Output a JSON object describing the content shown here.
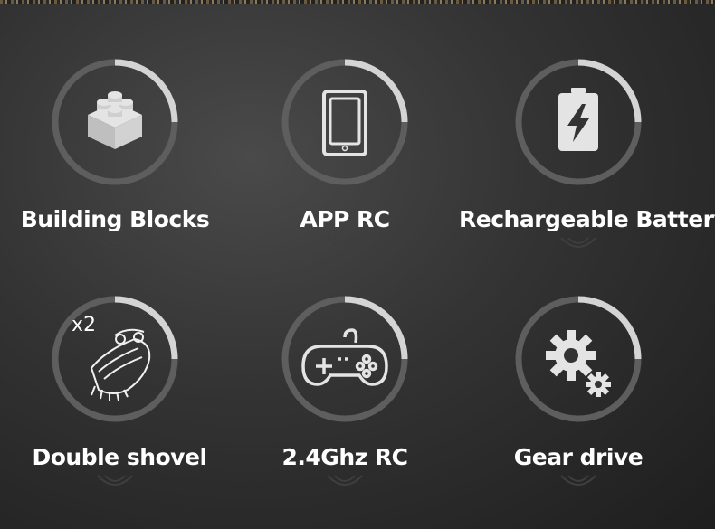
{
  "features": [
    {
      "label": "Building Blocks",
      "icon": "building-blocks-icon"
    },
    {
      "label": "APP RC",
      "icon": "smartphone-icon"
    },
    {
      "label": "Rechargeable Battery",
      "icon": "battery-charging-icon"
    },
    {
      "label": "Double shovel",
      "icon": "shovel-bucket-icon",
      "badge": "x2"
    },
    {
      "label": "2.4Ghz RC",
      "icon": "gamepad-icon"
    },
    {
      "label": "Gear drive",
      "icon": "gears-icon"
    }
  ],
  "colors": {
    "ring_track": "#6a6a6a",
    "ring_arc": "#d8d8d8",
    "icon": "#e6e6e6",
    "text": "#ffffff"
  }
}
